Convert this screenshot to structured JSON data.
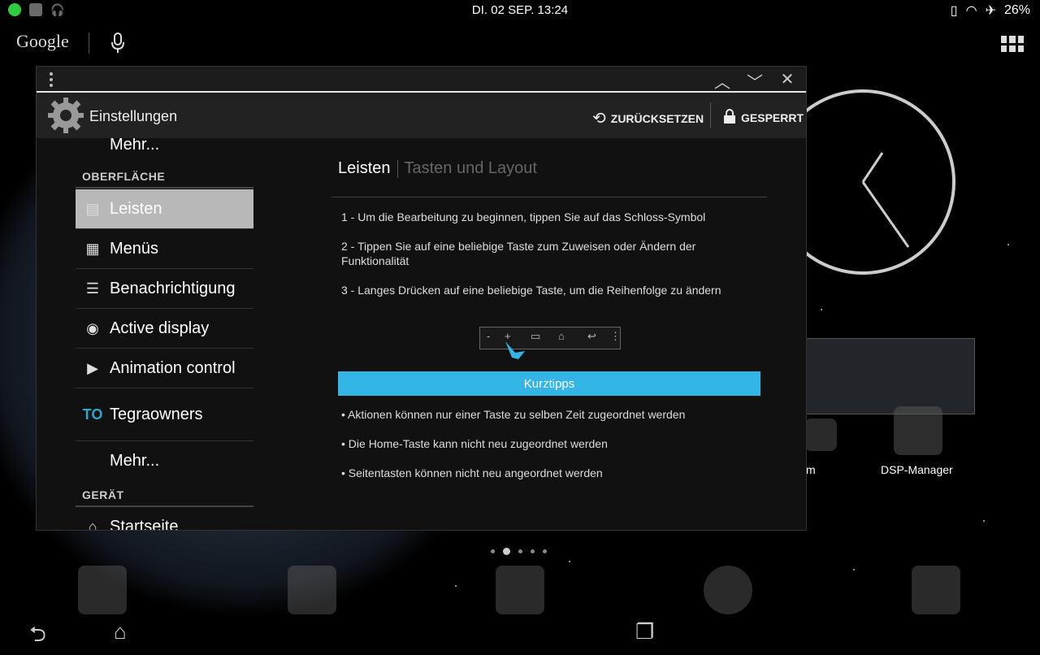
{
  "status_bar": {
    "datetime": "DI. 02 SEP. 13:24",
    "battery": "26%"
  },
  "home": {
    "google_label": "Google",
    "dsp_label": "DSP-Manager",
    "partial_label": "m"
  },
  "window": {
    "app_title": "Einstellungen",
    "reset_label": "ZURÜCKSETZEN",
    "locked_label": "GESPERRT"
  },
  "sidebar": {
    "top_more": "Mehr...",
    "section_surface": "OBERFLÄCHE",
    "items": [
      {
        "label": "Leisten",
        "icon": "bar-icon",
        "selected": true
      },
      {
        "label": "Menüs",
        "icon": "menu-icon"
      },
      {
        "label": "Benachrichtigung",
        "icon": "list-icon"
      },
      {
        "label": "Active display",
        "icon": "active-display-icon"
      },
      {
        "label": "Animation control",
        "icon": "animation-icon"
      },
      {
        "label": "Tegraowners",
        "icon": "tegraowners-icon"
      }
    ],
    "more": "Mehr...",
    "section_device": "GERÄT",
    "partial_item": "Startseite"
  },
  "main": {
    "tab_active": "Leisten",
    "tab_inactive": "Tasten und Layout",
    "steps": [
      "1 - Um die Bearbeitung zu beginnen, tippen Sie auf das Schloss-Symbol",
      "2 - Tippen Sie auf eine beliebige Taste zum Zuweisen oder Ändern der Funktionalität",
      "3 - Langes Drücken auf eine beliebige Taste, um die Reihenfolge zu ändern"
    ],
    "tips_header": "Kurztipps",
    "tips": [
      "• Aktionen können nur einer Taste zu selben Zeit zugeordnet werden",
      "• Die Home-Taste kann nicht neu zugeordnet werden",
      "• Seitentasten können nicht neu angeordnet werden"
    ]
  },
  "colors": {
    "accent": "#33b5e5",
    "selected_row": "#b8b8b8"
  }
}
